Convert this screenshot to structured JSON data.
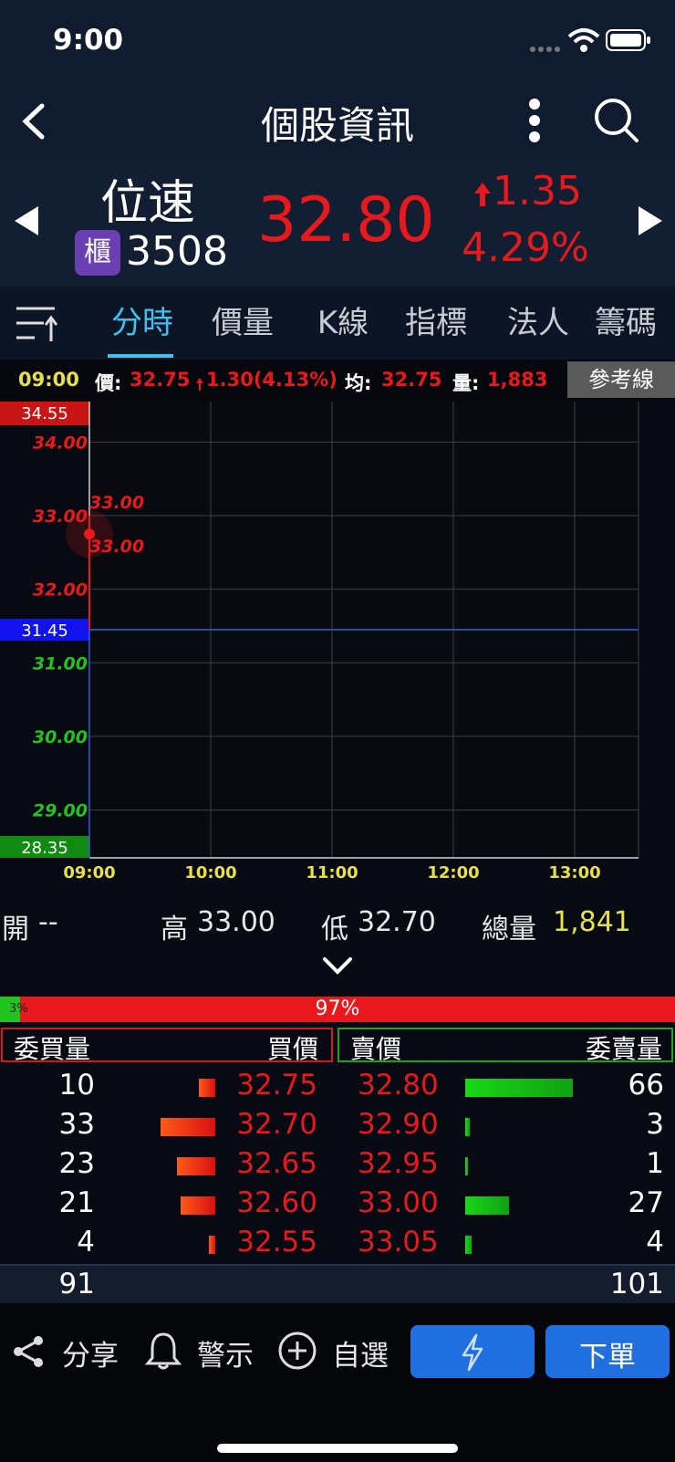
{
  "status": {
    "time": "9:00"
  },
  "nav": {
    "title": "個股資訊"
  },
  "stock": {
    "name": "位速",
    "market_badge": "櫃",
    "code": "3508",
    "price": "32.80",
    "change": "1.35",
    "change_pct": "4.29%",
    "up_color": "#e8191c"
  },
  "tabs": [
    {
      "label": "分時",
      "active": true
    },
    {
      "label": "價量"
    },
    {
      "label": "K線"
    },
    {
      "label": "指標"
    },
    {
      "label": "法人"
    },
    {
      "label": "籌碼"
    }
  ],
  "info_bar": {
    "time": "09:00",
    "price_label": "價:",
    "price": "32.75",
    "change": "1.30(4.13%)",
    "avg_label": "均:",
    "avg": "32.75",
    "vol_label": "量:",
    "vol": "1,883",
    "ref_button": "參考線"
  },
  "chart_data": {
    "type": "line",
    "x_ticks": [
      "09:00",
      "10:00",
      "11:00",
      "12:00",
      "13:00"
    ],
    "y_ticks": [
      "34.00",
      "33.00",
      "32.00",
      "31.00",
      "30.00",
      "29.00"
    ],
    "ylim": [
      28.35,
      34.55
    ],
    "upper_limit": "34.55",
    "reference_price": "31.45",
    "lower_limit": "28.35",
    "price_line": {
      "x": "09:00",
      "y_from": 31.45,
      "y_to": 33.0
    },
    "annotations": [
      "33.00",
      "33.00"
    ],
    "current_point": {
      "x": "09:00",
      "y": 32.75
    },
    "grid": true
  },
  "ohlc": {
    "open_label": "開",
    "open": "--",
    "high_label": "高",
    "high": "33.00",
    "low_label": "低",
    "low": "32.70",
    "total_label": "總量",
    "total": "1,841"
  },
  "book": {
    "buy_pct": "3%",
    "sell_pct": "97%",
    "buy_ratio": 0.03,
    "headers": {
      "bid_qty": "委買量",
      "bid_price": "買價",
      "ask_price": "賣價",
      "ask_qty": "委賣量"
    },
    "rows": [
      {
        "bid_qty": "10",
        "bid_price": "32.75",
        "ask_price": "32.80",
        "ask_qty": "66",
        "bid_q": 10,
        "ask_q": 66
      },
      {
        "bid_qty": "33",
        "bid_price": "32.70",
        "ask_price": "32.90",
        "ask_qty": "3",
        "bid_q": 33,
        "ask_q": 3
      },
      {
        "bid_qty": "23",
        "bid_price": "32.65",
        "ask_price": "32.95",
        "ask_qty": "1",
        "bid_q": 23,
        "ask_q": 1
      },
      {
        "bid_qty": "21",
        "bid_price": "32.60",
        "ask_price": "33.00",
        "ask_qty": "27",
        "bid_q": 21,
        "ask_q": 27
      },
      {
        "bid_qty": "4",
        "bid_price": "32.55",
        "ask_price": "33.05",
        "ask_qty": "4",
        "bid_q": 4,
        "ask_q": 4
      }
    ],
    "total_bid": "91",
    "total_ask": "101"
  },
  "actions": {
    "share": "分享",
    "alert": "警示",
    "watchlist": "自選",
    "order": "下單"
  },
  "colors": {
    "up": "#e8191c",
    "down": "#21c41f",
    "accent": "#3ec1f0",
    "yellow": "#e8e04a",
    "blue_button": "#1f6fe0"
  }
}
